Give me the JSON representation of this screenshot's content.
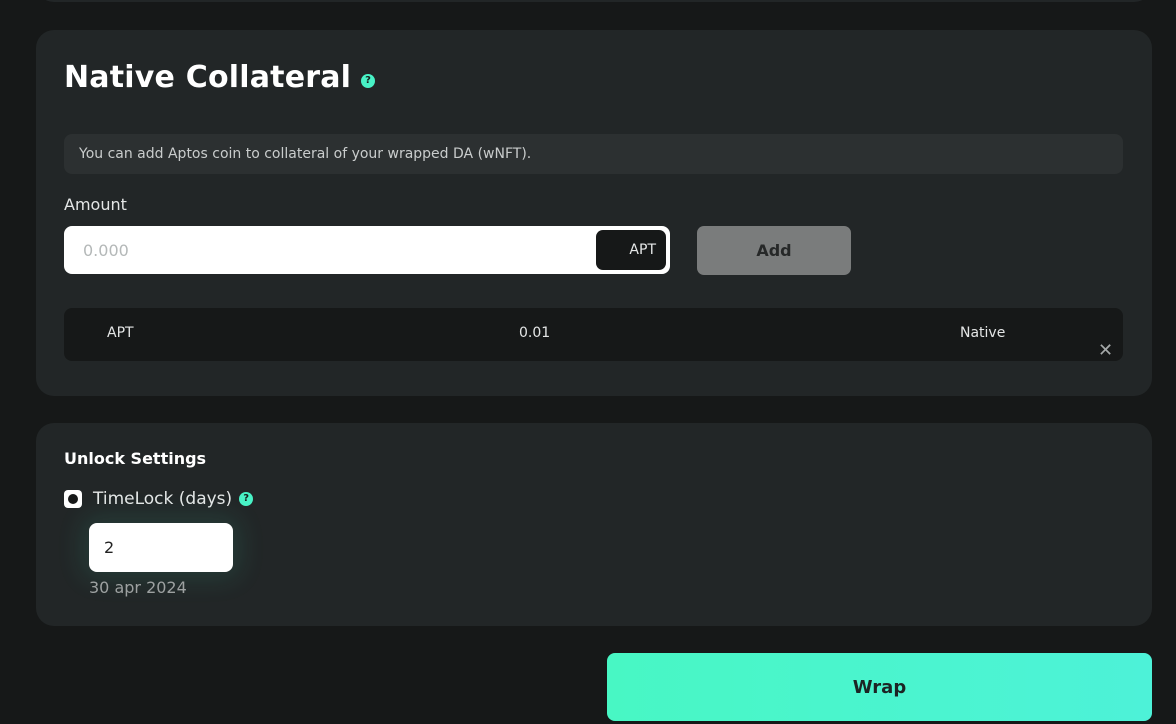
{
  "native_collateral": {
    "title": "Native Collateral",
    "help_glyph": "?",
    "info_text": "You can add Aptos coin to collateral of your wrapped DA (wNFT).",
    "amount_label": "Amount",
    "amount_value": "",
    "amount_placeholder": "0.000",
    "token": "APT",
    "add_label": "Add",
    "rows": [
      {
        "token": "APT",
        "amount": "0.01",
        "type": "Native"
      }
    ],
    "remove_glyph": "✕"
  },
  "unlock_settings": {
    "title": "Unlock Settings",
    "timelock_label": "TimeLock (days)",
    "timelock_checked": true,
    "days_value": "2",
    "unlock_date": "30 apr 2024"
  },
  "wrap_label": "Wrap",
  "colors": {
    "accent": "#48f2c6",
    "card": "#222627",
    "page": "#161818",
    "add_button": "#7a7c7c"
  }
}
